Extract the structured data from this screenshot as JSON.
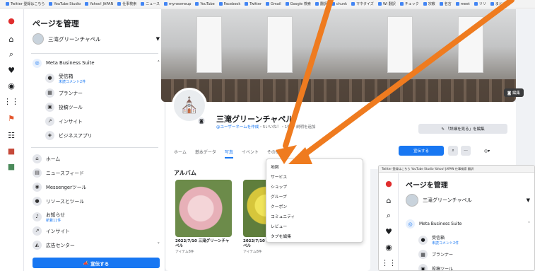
{
  "bookmarks": [
    "Twitter 登録はこちら",
    "YouTube Studio",
    "Yahoo! JAPAN",
    "仕事検索",
    "ニュース",
    "myneomeup",
    "YouTube",
    "Facebook",
    "Twitter",
    "Gmail",
    "Google 検索",
    "翻訳",
    "chunk",
    "マネタイズ",
    "Wi 翻訳",
    "チェック",
    "宗教",
    "名言",
    "meet",
    "リリ",
    "まとめ"
  ],
  "sidebar": {
    "title": "ページを管理",
    "page_name": "三滝グリーンチャペル",
    "meta_suite": "Meta Business Suite",
    "items": [
      {
        "label": "受信箱",
        "sub": "未読コメント2件"
      },
      {
        "label": "プランナー"
      },
      {
        "label": "投稿ツール"
      },
      {
        "label": "インサイト"
      },
      {
        "label": "ビジネスアプリ"
      }
    ],
    "nav": [
      {
        "label": "ホーム"
      },
      {
        "label": "ニュースフィード"
      },
      {
        "label": "Messengerツール"
      },
      {
        "label": "リソースとツール"
      },
      {
        "label": "お知らせ",
        "sub": "新着11件"
      },
      {
        "label": "インサイト"
      },
      {
        "label": "広告センター"
      }
    ],
    "promote": "宣伝する"
  },
  "page": {
    "name": "三滝グリーンチャペル",
    "meta_link": "@ユーザーネームを作成",
    "meta_rest": "・5いいね！・1件 ・説明を追加",
    "edit": "✎ 「詳細を見る」を編集",
    "cover_edit": "編集",
    "tabs": [
      "ホーム",
      "基本データ",
      "写真",
      "イベント",
      "その他 ▾"
    ],
    "promote": "宣伝する"
  },
  "album": {
    "title": "アルバム",
    "items": [
      {
        "caption": "2022/7/10 三滝グリーンチャペル",
        "count": "アイテム8件"
      },
      {
        "caption": "2022/7/10 三滝グリーンチャペル",
        "count": "アイテム8件"
      }
    ]
  },
  "dropdown": [
    "地図",
    "サービス",
    "ショップ",
    "グループ",
    "クーポン",
    "コミュニティ",
    "レビュー",
    "タブを編集"
  ],
  "overlay": {
    "bookmarks": "Twitter 登録はこちら  YouTube Studio  Yahoo! JAPAN  仕事検索  翻訳",
    "title": "ページを管理",
    "page_name": "三滝グリーンチャペル",
    "suite": "Meta Business Suite",
    "items": [
      {
        "label": "受信箱",
        "sub": "未読コメント2件"
      },
      {
        "label": "プランナー"
      },
      {
        "label": "投稿ツール"
      }
    ]
  },
  "colors": {
    "accent": "#1877f2",
    "arrow": "#ef7b1f"
  }
}
